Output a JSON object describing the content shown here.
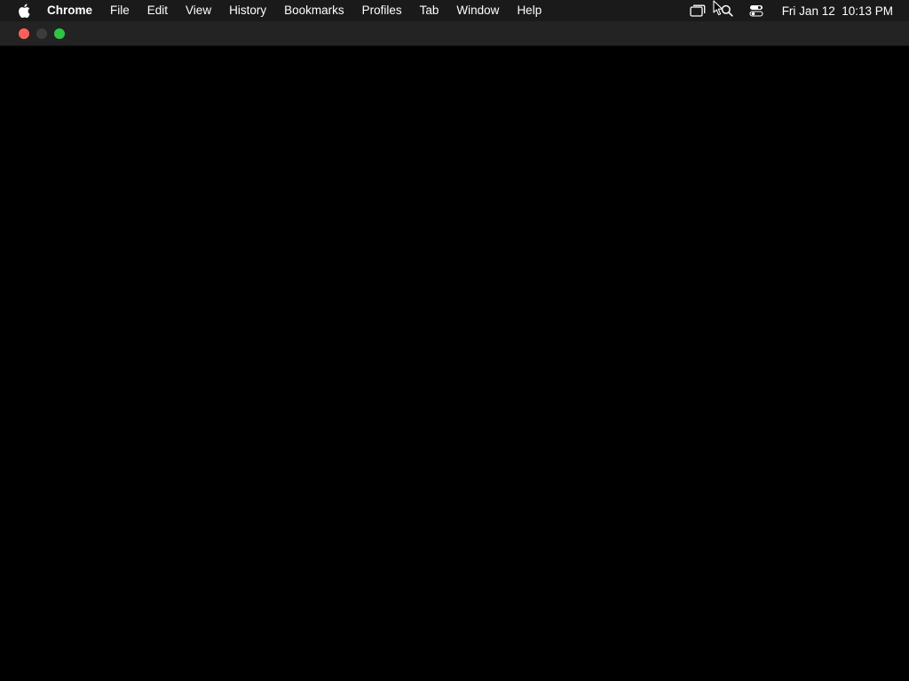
{
  "menubar": {
    "apple_icon": "apple-logo-icon",
    "app_name": "Chrome",
    "items": [
      {
        "label": "File"
      },
      {
        "label": "Edit"
      },
      {
        "label": "View"
      },
      {
        "label": "History"
      },
      {
        "label": "Bookmarks"
      },
      {
        "label": "Profiles"
      },
      {
        "label": "Tab"
      },
      {
        "label": "Window"
      },
      {
        "label": "Help"
      }
    ],
    "status_icons": [
      "screen-mirroring-icon",
      "spotlight-search-icon",
      "control-center-icon"
    ],
    "clock": "Fri Jan 12  10:13 PM"
  },
  "window": {
    "traffic_lights": {
      "close_color": "#ff5f57",
      "minimize_color": "#3c3c3c",
      "zoom_color": "#28c840"
    },
    "background": "#000000"
  }
}
